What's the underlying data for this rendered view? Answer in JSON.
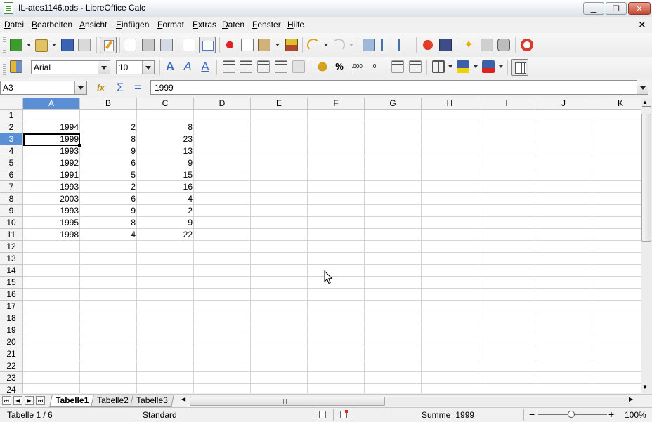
{
  "window": {
    "title": "IL-ates1146.ods - LibreOffice Calc",
    "min_glyph": "▁",
    "max_glyph": "❐",
    "close_glyph": "✕"
  },
  "menu": [
    {
      "label": "Datei",
      "accel": "D",
      "rest": "atei"
    },
    {
      "label": "Bearbeiten",
      "accel": "B",
      "rest": "earbeiten"
    },
    {
      "label": "Ansicht",
      "accel": "A",
      "rest": "nsicht"
    },
    {
      "label": "Einfügen",
      "accel": "E",
      "rest": "infügen"
    },
    {
      "label": "Format",
      "accel": "F",
      "rest": "ormat"
    },
    {
      "label": "Extras",
      "accel": "E",
      "rest": "xtras"
    },
    {
      "label": "Daten",
      "accel": "D",
      "rest": "aten"
    },
    {
      "label": "Fenster",
      "accel": "F",
      "rest": "enster"
    },
    {
      "label": "Hilfe",
      "accel": "H",
      "rest": "ilfe"
    }
  ],
  "formatting": {
    "font_name": "Arial",
    "font_size": "10"
  },
  "formula_bar": {
    "name_box": "A3",
    "content": "1999"
  },
  "grid": {
    "columns": [
      "A",
      "B",
      "C",
      "D",
      "E",
      "F",
      "G",
      "H",
      "I",
      "J",
      "K"
    ],
    "rows": [
      "1",
      "2",
      "3",
      "4",
      "5",
      "6",
      "7",
      "8",
      "9",
      "10",
      "11",
      "12",
      "13",
      "14",
      "15",
      "16",
      "17",
      "18",
      "19",
      "20",
      "21",
      "22",
      "23",
      "24"
    ],
    "active_cell": {
      "col": "A",
      "row": "3"
    },
    "data": [
      [
        "",
        "",
        ""
      ],
      [
        "1994",
        "2",
        "8"
      ],
      [
        "1999",
        "8",
        "23"
      ],
      [
        "1993",
        "9",
        "13"
      ],
      [
        "1992",
        "6",
        "9"
      ],
      [
        "1991",
        "5",
        "15"
      ],
      [
        "1993",
        "2",
        "16"
      ],
      [
        "2003",
        "6",
        "4"
      ],
      [
        "1993",
        "9",
        "2"
      ],
      [
        "1995",
        "8",
        "9"
      ],
      [
        "1998",
        "4",
        "22"
      ]
    ]
  },
  "sheets": [
    {
      "label": "Tabelle1",
      "active": true
    },
    {
      "label": "Tabelle2",
      "active": false
    },
    {
      "label": "Tabelle3",
      "active": false
    }
  ],
  "status": {
    "sheet_info": "Tabelle 1 / 6",
    "page_style": "Standard",
    "sum": "Summe=1999",
    "zoom": "100%"
  },
  "colors": {
    "accent": "#5a8fd6",
    "close_button": "#c6482f"
  }
}
